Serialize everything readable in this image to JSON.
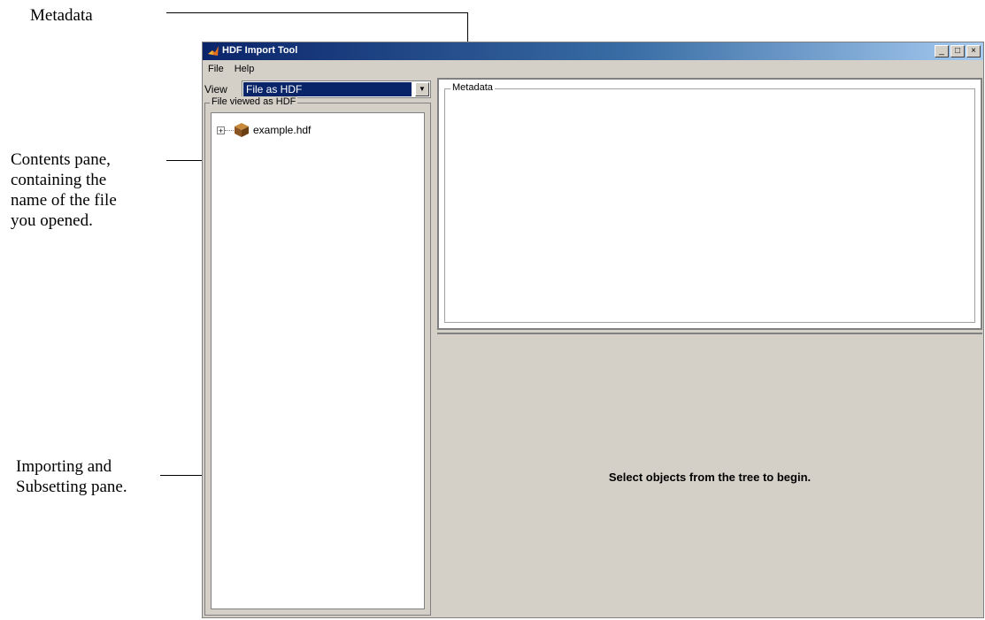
{
  "callouts": {
    "metadata": "Metadata",
    "contents_line1": "Contents pane,",
    "contents_line2": "containing the",
    "contents_line3": "name of the file",
    "contents_line4": "you opened.",
    "import_line1": "Importing and",
    "import_line2": "Subsetting pane."
  },
  "window": {
    "title": "HDF Import Tool",
    "minimize": "_",
    "maximize": "□",
    "close": "×"
  },
  "menu": [
    "File",
    "Help"
  ],
  "view": {
    "label": "View",
    "value": "File as HDF",
    "arrow": "▼"
  },
  "tree": {
    "legend": "File viewed as HDF",
    "expander": "+",
    "file_name": "example.hdf"
  },
  "metadata_pane": {
    "legend": "Metadata"
  },
  "import_pane": {
    "message": "Select objects from the tree to begin."
  },
  "colors": {
    "titlebar_start": "#0a246a",
    "titlebar_end": "#a6caf0",
    "selection": "#0a246a",
    "face": "#d4d0c8"
  }
}
